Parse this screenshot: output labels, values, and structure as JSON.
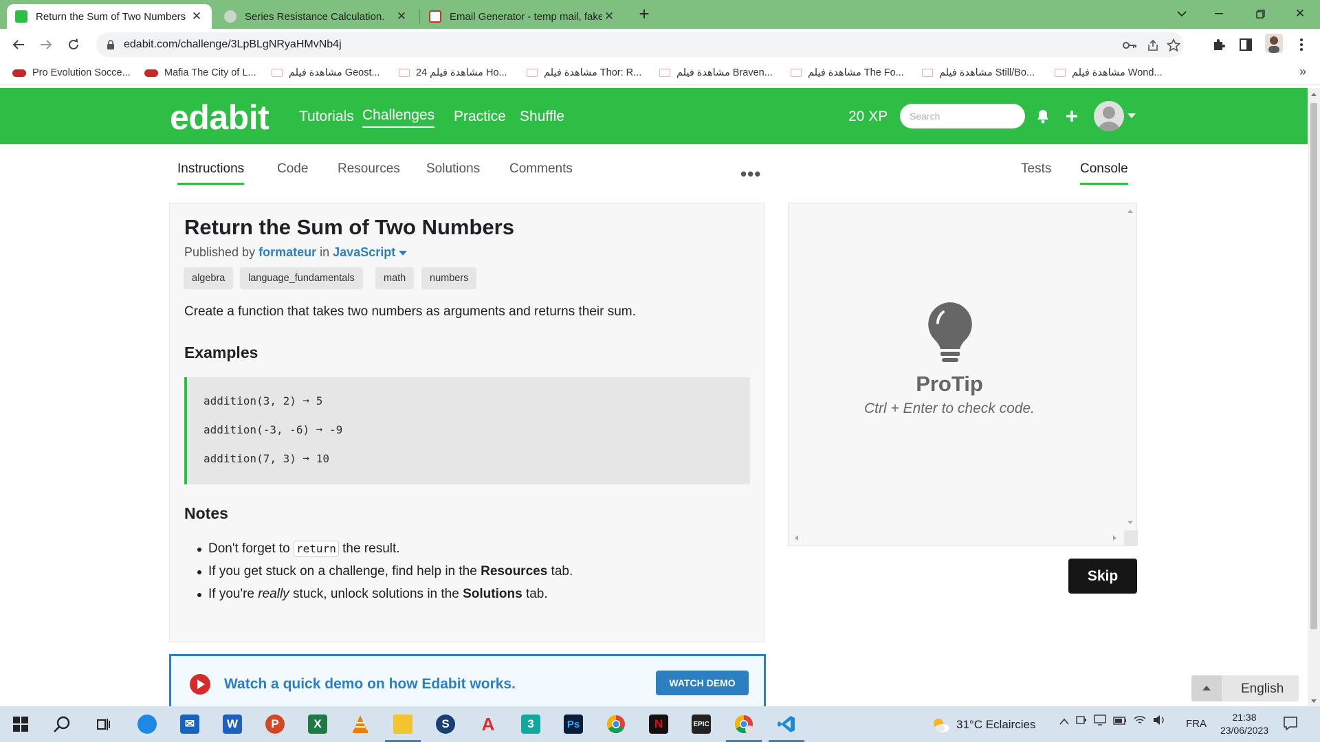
{
  "browser": {
    "tabs": [
      {
        "title": "Return the Sum of Two Numbers",
        "active": true
      },
      {
        "title": "Series Resistance Calculation.",
        "active": false
      },
      {
        "title": "Email Generator - temp mail, fake",
        "active": false
      }
    ],
    "url": "edabit.com/challenge/3LpBLgNRyaHMvNb4j",
    "bookmarks": [
      "Pro Evolution Socce...",
      "Mafia The City of L...",
      "مشاهدة فيلم Geost...",
      "مشاهدة فيلم 24 Ho...",
      "مشاهدة فيلم Thor: R...",
      "مشاهدة فيلم Braven...",
      "مشاهدة فيلم The Fo...",
      "مشاهدة فيلم Still/Bo...",
      "مشاهدة فيلم Wond..."
    ]
  },
  "site": {
    "logo": "edabit",
    "nav": [
      "Tutorials",
      "Challenges",
      "Practice",
      "Shuffle"
    ],
    "active_nav": "Challenges",
    "xp": "20 XP",
    "search_placeholder": "Search"
  },
  "page_tabs": {
    "left": [
      "Instructions",
      "Code",
      "Resources",
      "Solutions",
      "Comments"
    ],
    "right": [
      "Tests",
      "Console"
    ],
    "more": "•••"
  },
  "challenge": {
    "title": "Return the Sum of Two Numbers",
    "published_by": "Published by",
    "author": "formateur",
    "in": "in",
    "language": "JavaScript",
    "tags": [
      "algebra",
      "language_fundamentals",
      "math",
      "numbers"
    ],
    "description": "Create a function that takes two numbers as arguments and returns their sum.",
    "examples_heading": "Examples",
    "examples": [
      "addition(3, 2) ➞ 5",
      "addition(-3, -6) ➞ -9",
      "addition(7, 3) ➞ 10"
    ],
    "notes_heading": "Notes",
    "notes": {
      "n1_pre": "Don't forget to ",
      "n1_code": "return",
      "n1_post": " the result.",
      "n2_pre": "If you get stuck on a challenge, find help in the ",
      "n2_bold": "Resources",
      "n2_post": " tab.",
      "n3_pre": "If you're ",
      "n3_em": "really",
      "n3_mid": " stuck, unlock solutions in the ",
      "n3_bold": "Solutions",
      "n3_post": " tab."
    }
  },
  "demo": {
    "text": "Watch a quick demo on how Edabit works.",
    "button": "WATCH DEMO"
  },
  "console": {
    "protip_title": "ProTip",
    "protip_text": "Ctrl + Enter to check code.",
    "skip": "Skip"
  },
  "language_selector": "English",
  "taskbar": {
    "weather": "31°C  Eclaircies",
    "ime": "FRA",
    "time": "21:38",
    "date": "23/06/2023"
  },
  "colors": {
    "brand_green": "#2ebd45",
    "link_blue": "#2c7fc0",
    "chrome_frame": "#7fbf7f",
    "skip_button": "#161616"
  }
}
